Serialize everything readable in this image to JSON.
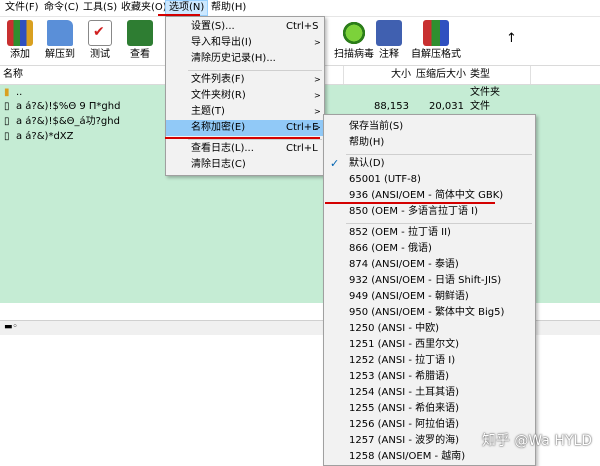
{
  "menubar": {
    "items": [
      "文件(F)",
      "命令(C)",
      "工具(S)",
      "收藏夹(O)",
      "选项(N)",
      "帮助(H)"
    ]
  },
  "toolbar": {
    "buttons": [
      "添加",
      "解压到",
      "测试",
      "查看"
    ],
    "right_buttons": [
      "扫描病毒",
      "注释",
      "自解压格式"
    ],
    "up_arrow": "↑"
  },
  "columns": {
    "name": "名称",
    "size": "大小",
    "packed": "压缩后大小",
    "type": "类型"
  },
  "rows": [
    {
      "name": "..",
      "size": "",
      "packed": "",
      "type": "文件夹"
    },
    {
      "name": "a  á?&)!$%Θ  9 Π*ghd",
      "size": "88,153",
      "packed": "20,031",
      "type": "文件"
    },
    {
      "name": "a  á?&)!$&Θ_á功?ghd",
      "size": "",
      "packed": "",
      "type": ""
    },
    {
      "name": "a  á?&)*dXZ",
      "size": "",
      "packed": "",
      "type": ""
    }
  ],
  "options_menu": [
    {
      "label": "设置(S)...",
      "shortcut": "Ctrl+S"
    },
    {
      "label": "导入和导出(I)",
      "submenu": true
    },
    {
      "label": "清除历史记录(H)..."
    },
    {
      "label": "文件列表(F)",
      "submenu": true
    },
    {
      "label": "文件夹树(R)",
      "submenu": true
    },
    {
      "label": "主题(T)",
      "submenu": true
    },
    {
      "label": "名称加密(E)",
      "shortcut": "Ctrl+E",
      "submenu": true
    },
    {
      "label": "查看日志(L)...",
      "shortcut": "Ctrl+L"
    },
    {
      "label": "清除日志(C)"
    }
  ],
  "encoding_menu": [
    "保存当前(S)",
    "帮助(H)",
    "默认(D)",
    "65001 (UTF-8)",
    "936  (ANSI/OEM - 简体中文 GBK)",
    "850  (OEM - 多语言拉丁语 I)",
    "852  (OEM - 拉丁语 II)",
    "866  (OEM - 俄语)",
    "874  (ANSI/OEM - 泰语)",
    "932  (ANSI/OEM - 日语 Shift-JIS)",
    "949  (ANSI/OEM - 朝鲜语)",
    "950  (ANSI/OEM - 繁体中文 Big5)",
    "1250  (ANSI - 中欧)",
    "1251  (ANSI - 西里尔文)",
    "1252  (ANSI - 拉丁语 I)",
    "1253  (ANSI - 希腊语)",
    "1254  (ANSI - 土耳其语)",
    "1255  (ANSI - 希伯来语)",
    "1256  (ANSI - 阿拉伯语)",
    "1257  (ANSI - 波罗的海)",
    "1258  (ANSI/OEM - 越南)"
  ],
  "watermark": "知乎 @Wa HYLD",
  "colors": {
    "accent": "#d40000",
    "highlight": "#91c9f7",
    "list_bg": "#c5ecd4"
  }
}
